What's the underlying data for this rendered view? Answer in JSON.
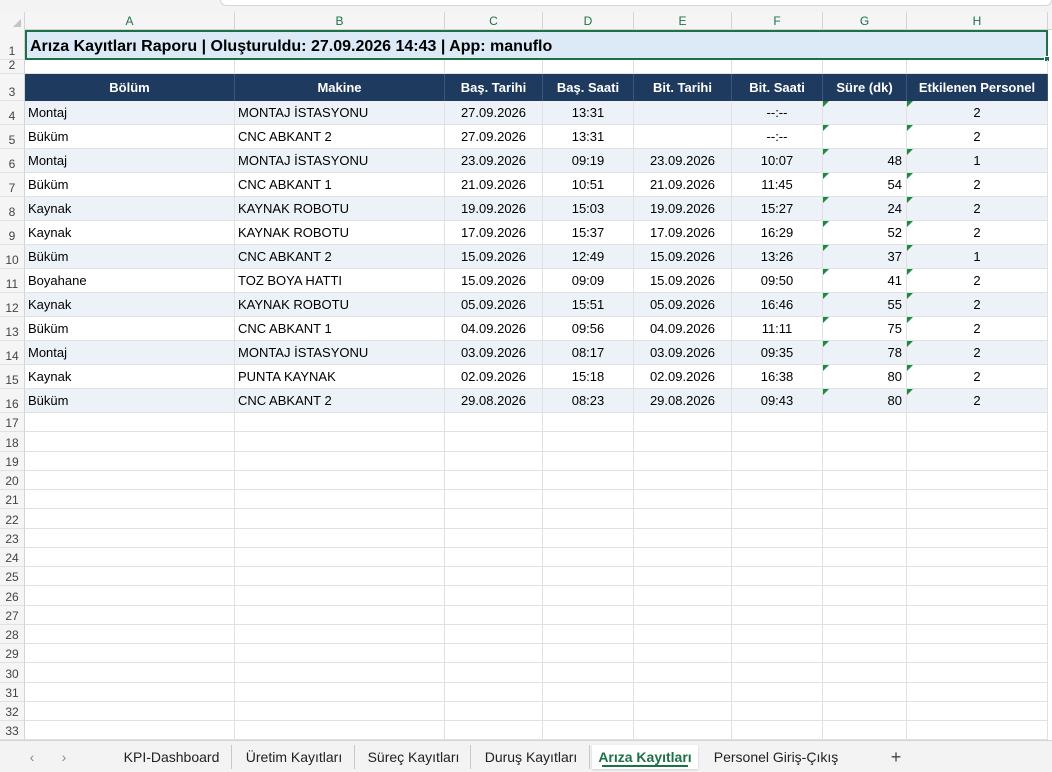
{
  "columns": [
    "A",
    "B",
    "C",
    "D",
    "E",
    "F",
    "G",
    "H"
  ],
  "title": "Arıza Kayıtları Raporu  |  Oluşturuldu: 27.09.2026 14:43  |  App: manuflo",
  "headers": [
    "Bölüm",
    "Makine",
    "Baş. Tarihi",
    "Baş. Saati",
    "Bit. Tarihi",
    "Bit. Saati",
    "Süre (dk)",
    "Etkilenen Personel"
  ],
  "rows": [
    [
      "Montaj",
      "MONTAJ İSTASYONU",
      "27.09.2026",
      "13:31",
      "",
      "--:--",
      "",
      "2"
    ],
    [
      "Büküm",
      "CNC ABKANT 2",
      "27.09.2026",
      "13:31",
      "",
      "--:--",
      "",
      "2"
    ],
    [
      "Montaj",
      "MONTAJ İSTASYONU",
      "23.09.2026",
      "09:19",
      "23.09.2026",
      "10:07",
      "48",
      "1"
    ],
    [
      "Büküm",
      "CNC ABKANT 1",
      "21.09.2026",
      "10:51",
      "21.09.2026",
      "11:45",
      "54",
      "2"
    ],
    [
      "Kaynak",
      "KAYNAK ROBOTU",
      "19.09.2026",
      "15:03",
      "19.09.2026",
      "15:27",
      "24",
      "2"
    ],
    [
      "Kaynak",
      "KAYNAK ROBOTU",
      "17.09.2026",
      "15:37",
      "17.09.2026",
      "16:29",
      "52",
      "2"
    ],
    [
      "Büküm",
      "CNC ABKANT 2",
      "15.09.2026",
      "12:49",
      "15.09.2026",
      "13:26",
      "37",
      "1"
    ],
    [
      "Boyahane",
      "TOZ BOYA HATTI",
      "15.09.2026",
      "09:09",
      "15.09.2026",
      "09:50",
      "41",
      "2"
    ],
    [
      "Kaynak",
      "KAYNAK ROBOTU",
      "05.09.2026",
      "15:51",
      "05.09.2026",
      "16:46",
      "55",
      "2"
    ],
    [
      "Büküm",
      "CNC ABKANT 1",
      "04.09.2026",
      "09:56",
      "04.09.2026",
      "11:11",
      "75",
      "2"
    ],
    [
      "Montaj",
      "MONTAJ İSTASYONU",
      "03.09.2026",
      "08:17",
      "03.09.2026",
      "09:35",
      "78",
      "2"
    ],
    [
      "Kaynak",
      "PUNTA KAYNAK",
      "02.09.2026",
      "15:18",
      "02.09.2026",
      "16:38",
      "80",
      "2"
    ],
    [
      "Büküm",
      "CNC ABKANT 2",
      "29.08.2026",
      "08:23",
      "29.08.2026",
      "09:43",
      "80",
      "2"
    ]
  ],
  "row_numbers": [
    "1",
    "2",
    "3",
    "4",
    "5",
    "6",
    "7",
    "8",
    "9",
    "10",
    "11",
    "12",
    "13",
    "14",
    "15",
    "16",
    "17",
    "18",
    "19",
    "20",
    "21",
    "22",
    "23",
    "24",
    "25",
    "26",
    "27",
    "28",
    "29",
    "30",
    "31",
    "32",
    "33"
  ],
  "sheet_tabs": [
    "KPI-Dashboard",
    "Üretim Kayıtları",
    "Süreç Kayıtları",
    "Duruş Kayıtları",
    "Arıza Kayıtları",
    "Personel Giriş-Çıkış"
  ],
  "active_tab": "Arıza Kayıtları",
  "nav": {
    "prev": "‹",
    "next": "›",
    "add": "+"
  },
  "colors": {
    "header_bg": "#1f3a5f",
    "title_bg": "#dce9f7",
    "alt_row": "#edf2f9",
    "accent": "#1e7145"
  }
}
